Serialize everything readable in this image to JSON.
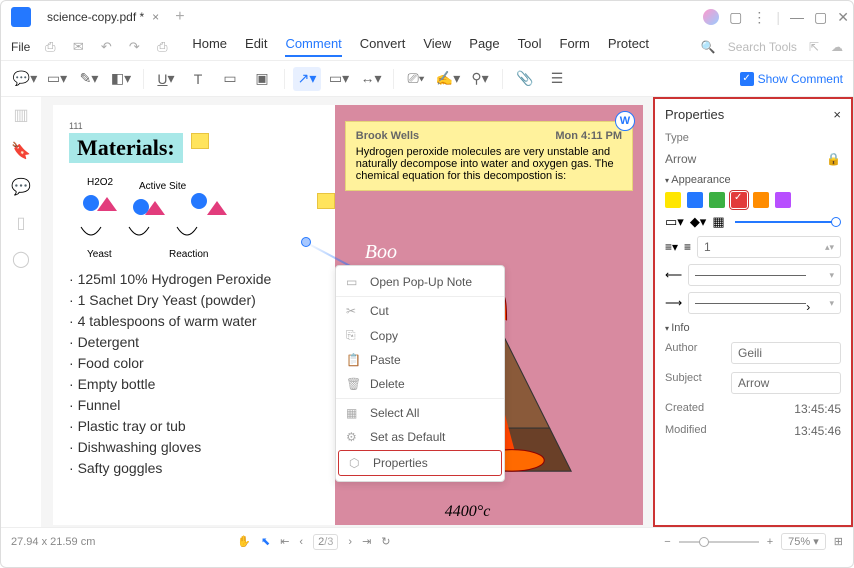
{
  "tab": {
    "title": "science-copy.pdf *"
  },
  "menu": {
    "file": "File"
  },
  "tabs": [
    "Home",
    "Edit",
    "Comment",
    "Convert",
    "View",
    "Page",
    "Tool",
    "Form",
    "Protect"
  ],
  "active_tab": "Comment",
  "search_placeholder": "Search Tools",
  "show_comment": "Show Comment",
  "document": {
    "materials_heading": "Materials:",
    "labels": {
      "h2o2": "H2O2",
      "active_site": "Active Site",
      "yeast": "Yeast",
      "reaction": "Reaction"
    },
    "list": [
      "125ml 10% Hydrogen Peroxide",
      "1 Sachet Dry Yeast (powder)",
      "4 tablespoons of warm water",
      "Detergent",
      "Food color",
      "Empty bottle",
      "Funnel",
      "Plastic tray or tub",
      "Dishwashing gloves",
      "Safty goggles"
    ],
    "sticky": {
      "author": "Brook Wells",
      "time": "Mon 4:11 PM",
      "body": "Hydrogen peroxide molecules are very unstable and naturally decompose into water and oxygen gas. The chemical equation for this decompostion is:"
    },
    "volcano_boo": "Boo",
    "temp": "4400°c"
  },
  "context_menu": {
    "items": [
      "Open Pop-Up Note",
      "Cut",
      "Copy",
      "Paste",
      "Delete",
      "Select All",
      "Set as Default",
      "Properties"
    ]
  },
  "properties": {
    "panel_title": "Properties",
    "type_label": "Type",
    "type_value": "Arrow",
    "appearance_label": "Appearance",
    "colors": [
      "#ffe600",
      "#2478ff",
      "#3cb043",
      "#e23c3c",
      "#ff8c00",
      "#b84fff"
    ],
    "selected_color_index": 3,
    "thickness": "1",
    "info_label": "Info",
    "author_label": "Author",
    "author": "Geili",
    "subject_label": "Subject",
    "subject": "Arrow",
    "created_label": "Created",
    "created": "13:45:45",
    "modified_label": "Modified",
    "modified": "13:45:46"
  },
  "status": {
    "dims": "27.94 x 21.59 cm",
    "page": "2",
    "pages": "/3",
    "zoom": "75%"
  }
}
